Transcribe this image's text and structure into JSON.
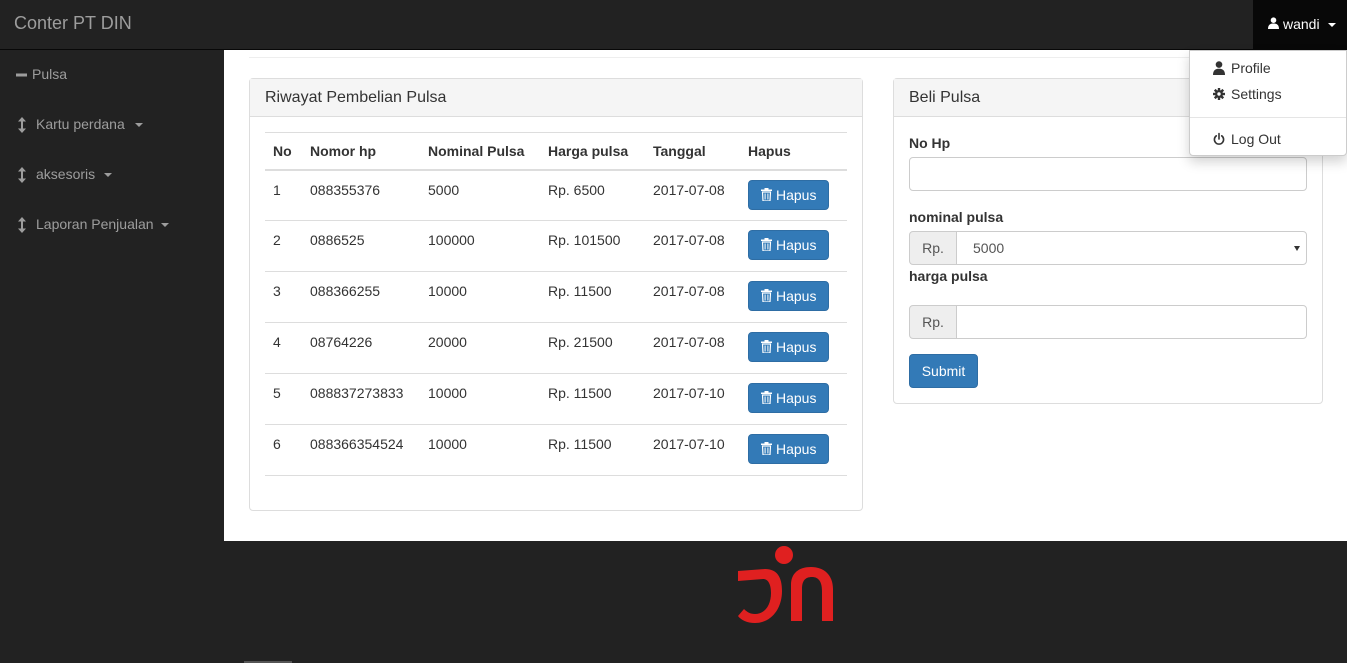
{
  "app": {
    "brand": "Conter PT DIN"
  },
  "user_menu": {
    "username": "wandi",
    "items": [
      {
        "label": "Profile",
        "icon": "user-icon"
      },
      {
        "label": "Settings",
        "icon": "gear-icon"
      },
      {
        "label": "Log Out",
        "icon": "power-icon"
      }
    ]
  },
  "sidebar": {
    "items": [
      {
        "label": "Pulsa",
        "icon": "minus-icon",
        "has_dropdown": false
      },
      {
        "label": "Kartu perdana",
        "icon": "vertical-resize-icon",
        "has_dropdown": true
      },
      {
        "label": "aksesoris",
        "icon": "vertical-resize-icon",
        "has_dropdown": true
      },
      {
        "label": "Laporan Penjualan",
        "icon": "vertical-resize-icon",
        "has_dropdown": true
      }
    ]
  },
  "history": {
    "title": "Riwayat Pembelian Pulsa",
    "columns": [
      "No",
      "Nomor hp",
      "Nominal Pulsa",
      "Harga pulsa",
      "Tanggal",
      "Hapus"
    ],
    "rows": [
      {
        "no": "1",
        "phone": "088355376",
        "nominal": "5000",
        "price": "Rp. 6500",
        "date": "2017-07-08"
      },
      {
        "no": "2",
        "phone": "0886525",
        "nominal": "100000",
        "price": "Rp. 101500",
        "date": "2017-07-08"
      },
      {
        "no": "3",
        "phone": "088366255",
        "nominal": "10000",
        "price": "Rp. 11500",
        "date": "2017-07-08"
      },
      {
        "no": "4",
        "phone": "08764226",
        "nominal": "20000",
        "price": "Rp. 21500",
        "date": "2017-07-08"
      },
      {
        "no": "5",
        "phone": "088837273833",
        "nominal": "10000",
        "price": "Rp. 11500",
        "date": "2017-07-10"
      },
      {
        "no": "6",
        "phone": "088366354524",
        "nominal": "10000",
        "price": "Rp. 11500",
        "date": "2017-07-10"
      }
    ],
    "delete_label": "Hapus"
  },
  "buy_form": {
    "title": "Beli Pulsa",
    "phone_label": "No Hp",
    "phone_value": "",
    "nominal_label": "nominal pulsa",
    "currency_prefix": "Rp.",
    "nominal_selected": "5000",
    "price_label": "harga pulsa",
    "price_value": "",
    "submit_label": "Submit"
  },
  "colors": {
    "navbar": "#222222",
    "primary_button": "#337ab7",
    "logo_red": "#e02020"
  }
}
